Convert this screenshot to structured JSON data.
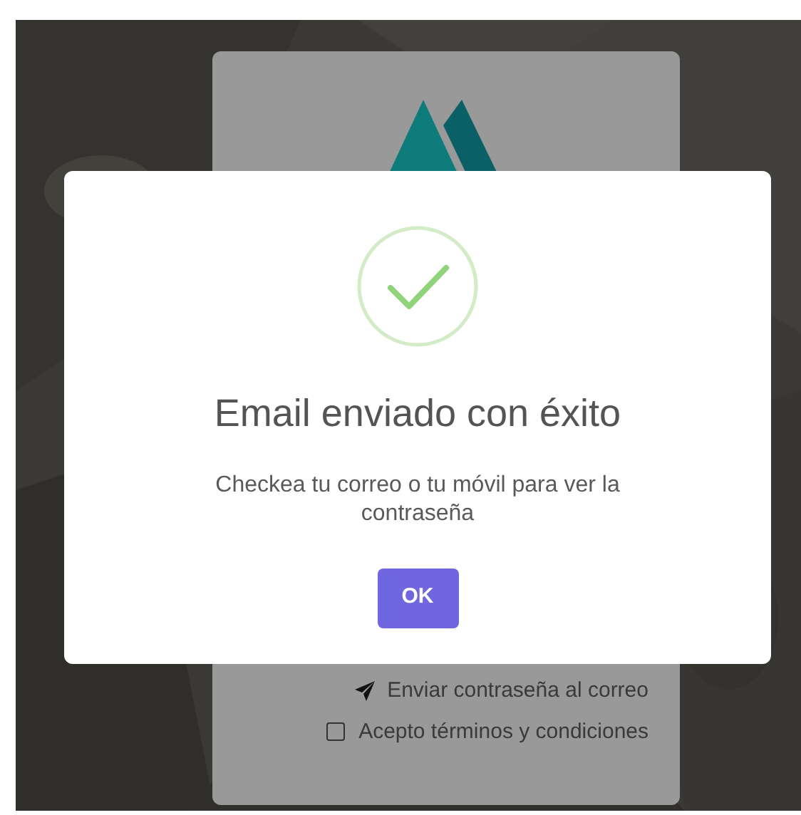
{
  "login_card": {
    "send_link": "Enviar contraseña al correo",
    "terms": {
      "label": "Acepto términos y condiciones",
      "checked": false
    }
  },
  "dialog": {
    "kind": "success",
    "title": "Email enviado con éxito",
    "message": "Checkea tu correo o tu móvil para ver la contraseña",
    "button": "OK"
  }
}
